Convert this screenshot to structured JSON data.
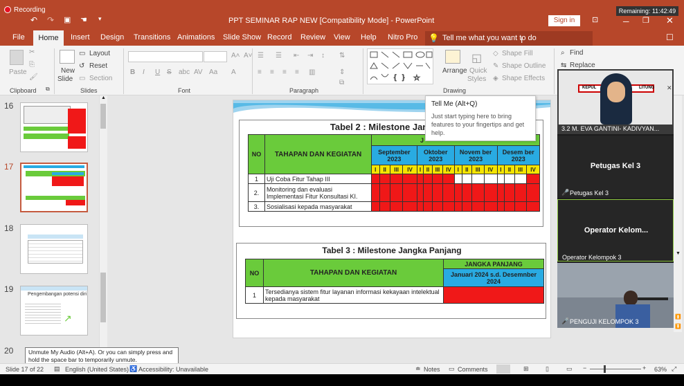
{
  "recording": "Recording",
  "remaining": "Remaining: 11:42:49",
  "window_title": "PPT SEMINAR RAP NEW [Compatibility Mode] - PowerPoint",
  "sign_in": "Sign in",
  "menu": {
    "file": "File",
    "home": "Home",
    "insert": "Insert",
    "design": "Design",
    "transitions": "Transitions",
    "animations": "Animations",
    "slideshow": "Slide Show",
    "record": "Record",
    "review": "Review",
    "view": "View",
    "help": "Help",
    "nitro": "Nitro Pro"
  },
  "tell_me": "Tell me what you want to do",
  "ribbon": {
    "clipboard": "Clipboard",
    "paste": "Paste",
    "new_slide": "New",
    "new_slide2": "Slide",
    "layout": "Layout",
    "reset": "Reset",
    "section": "Section",
    "slides": "Slides",
    "font": "Font",
    "paragraph": "Paragraph",
    "arrange": "Arrange",
    "quick": "Quick",
    "styles": "Styles",
    "shape_fill": "Shape Fill",
    "shape_outline": "Shape Outline",
    "shape_effects": "Shape Effects",
    "drawing": "Drawing",
    "find": "Find",
    "replace": "Replace"
  },
  "tooltip": {
    "title": "Tell Me (Alt+Q)",
    "body": "Just start typing here to bring features to your fingertips and get help."
  },
  "thumbs": [
    {
      "num": "16"
    },
    {
      "num": "17"
    },
    {
      "num": "18"
    },
    {
      "num": "19",
      "title": "Pengembangan potensi diri"
    },
    {
      "num": "20"
    }
  ],
  "table2": {
    "title": "Tabel 2 : Milestone Jangka M",
    "no": "NO",
    "tahapan": "TAHAPAN DAN KEGIATAN",
    "top": "J",
    "months": [
      "September 2023",
      "Oktober 2023",
      "Novem ber 2023",
      "Desem ber 2023"
    ],
    "weeks": [
      "I",
      "II",
      "III",
      "IV"
    ],
    "rows": [
      {
        "no": "1",
        "text": "Uji Coba Fitur Tahap III"
      },
      {
        "no": "2.",
        "text": "Monitoring dan evaluasi Implementasi Fitur Konsultasi KI."
      },
      {
        "no": "3.",
        "text": "Sosialisasi kepada masyarakat"
      }
    ]
  },
  "table3": {
    "title": "Tabel 3 : Milestone Jangka Panjang",
    "no": "NO",
    "tahapan": "TAHAPAN DAN KEGIATAN",
    "jangka": "JANGKA PANJANG",
    "period": "Januari 2024 s.d. Desemnber 2024",
    "rows": [
      {
        "no": "1",
        "text": "Tersedianya sistem fitur layanan informasi kekayaan intelektual kepada masyarakat"
      }
    ]
  },
  "video": [
    {
      "name": "3.2 M. EVA GANTINI- KADIVYAN...",
      "banner": "KEPUL",
      "banner2": "LITUNG"
    },
    {
      "name": "Petugas Kel 3",
      "center": "Petugas Kel 3"
    },
    {
      "name": "Operator Kelompok 3",
      "center": "Operator Kelom..."
    },
    {
      "name": "PENGUJI KELOMPOK 3"
    }
  ],
  "unmute_tip": "Unmute My Audio (Alt+A). Or you can simply press and hold the space bar to temporarily unmute.",
  "status": {
    "slide": "Slide 17 of 22",
    "lang": "English (United States)",
    "access": "Accessibility: Unavailable",
    "notes": "Notes",
    "comments": "Comments",
    "zoom": "63%"
  },
  "colors": {
    "accent": "#b7472a",
    "green": "#6acb3b",
    "blue": "#29abe2",
    "yellow": "#f5e400",
    "red": "#f01818"
  }
}
